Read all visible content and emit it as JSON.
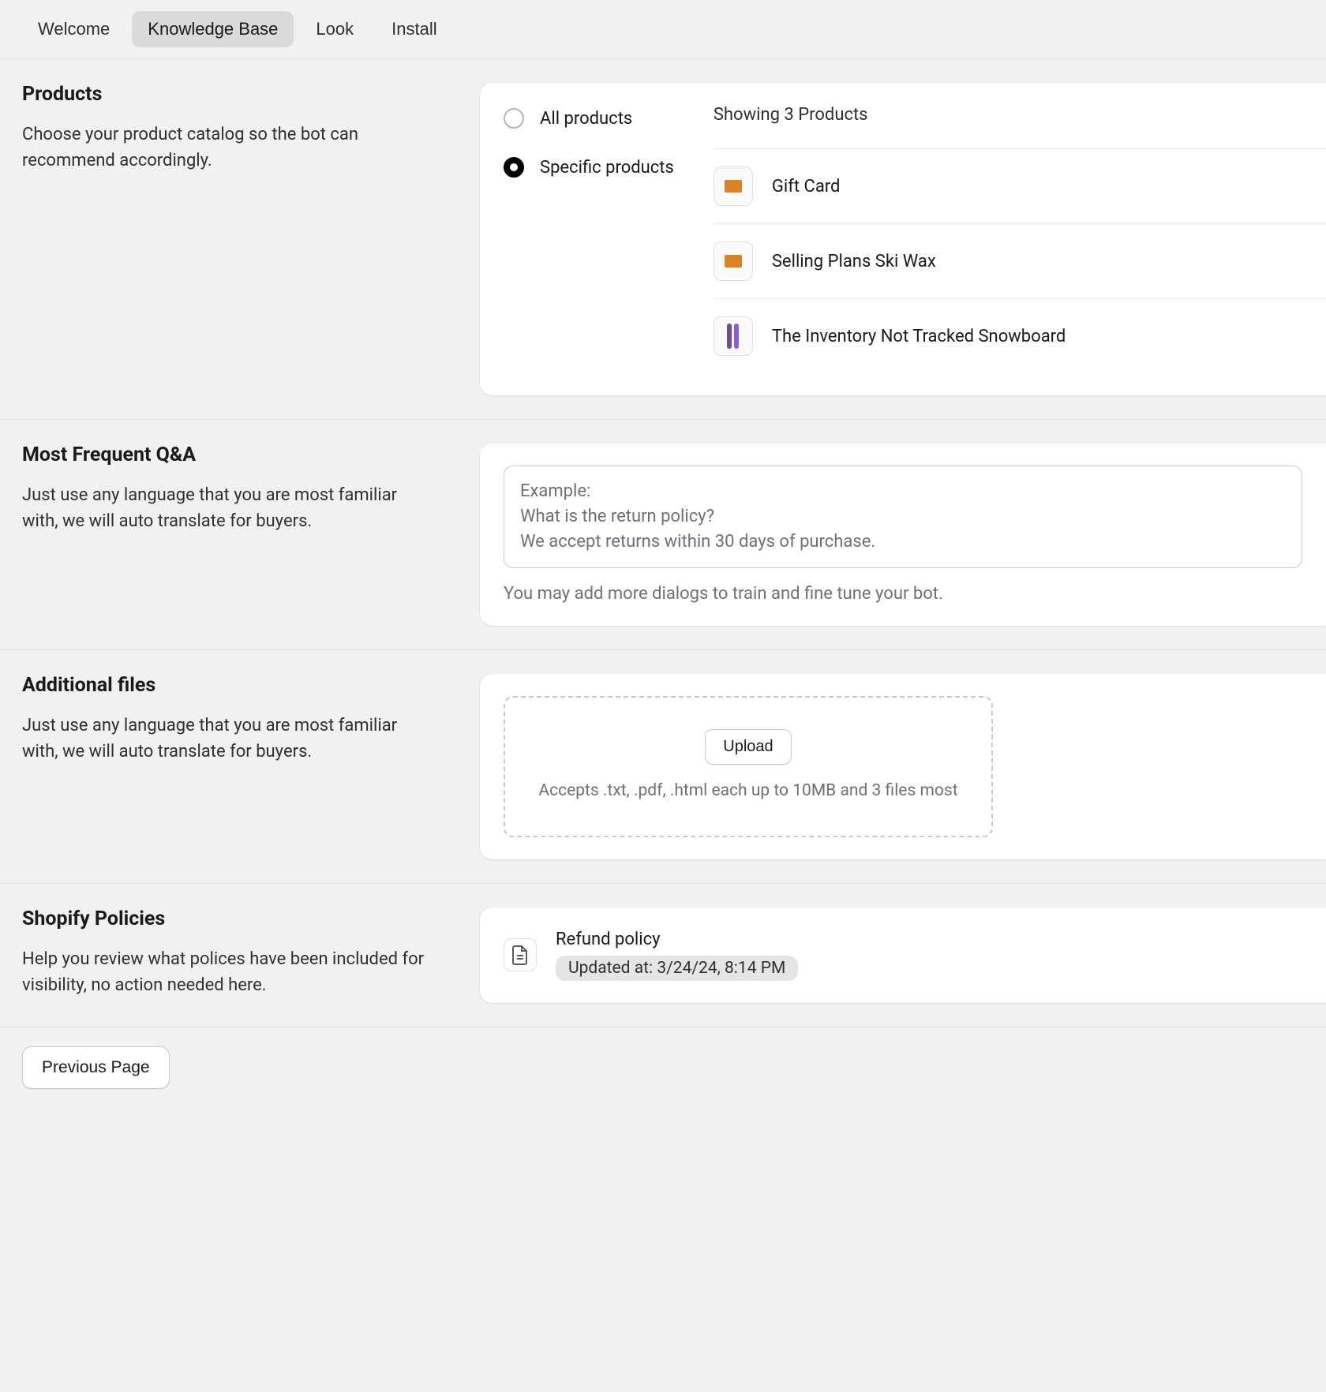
{
  "tabs": {
    "welcome": "Welcome",
    "knowledge_base": "Knowledge Base",
    "look": "Look",
    "install": "Install"
  },
  "products": {
    "title": "Products",
    "desc": "Choose your product catalog so the bot can recommend accordingly.",
    "radio_all": "All products",
    "radio_specific": "Specific products",
    "showing": "Showing 3 Products",
    "items": [
      {
        "name": "Gift Card"
      },
      {
        "name": "Selling Plans Ski Wax"
      },
      {
        "name": "The Inventory Not Tracked Snowboard"
      }
    ]
  },
  "qa": {
    "title": "Most Frequent Q&A",
    "desc": "Just use any language that you are most familiar with, we will auto translate for buyers.",
    "placeholder": "Example:\nWhat is the return policy?\nWe accept returns within 30 days of purchase.",
    "hint": "You may add more dialogs to train and fine tune your bot."
  },
  "files": {
    "title": "Additional files",
    "desc": "Just use any language that you are most familiar with, we will auto translate for buyers.",
    "upload_label": "Upload",
    "hint": "Accepts .txt, .pdf, .html each up to 10MB and 3 files most"
  },
  "policies": {
    "title": "Shopify Policies",
    "desc": "Help you review what polices have been included for visibility, no action needed here.",
    "item_title": "Refund policy",
    "item_badge": "Updated at: 3/24/24, 8:14 PM"
  },
  "footer": {
    "prev": "Previous Page"
  }
}
